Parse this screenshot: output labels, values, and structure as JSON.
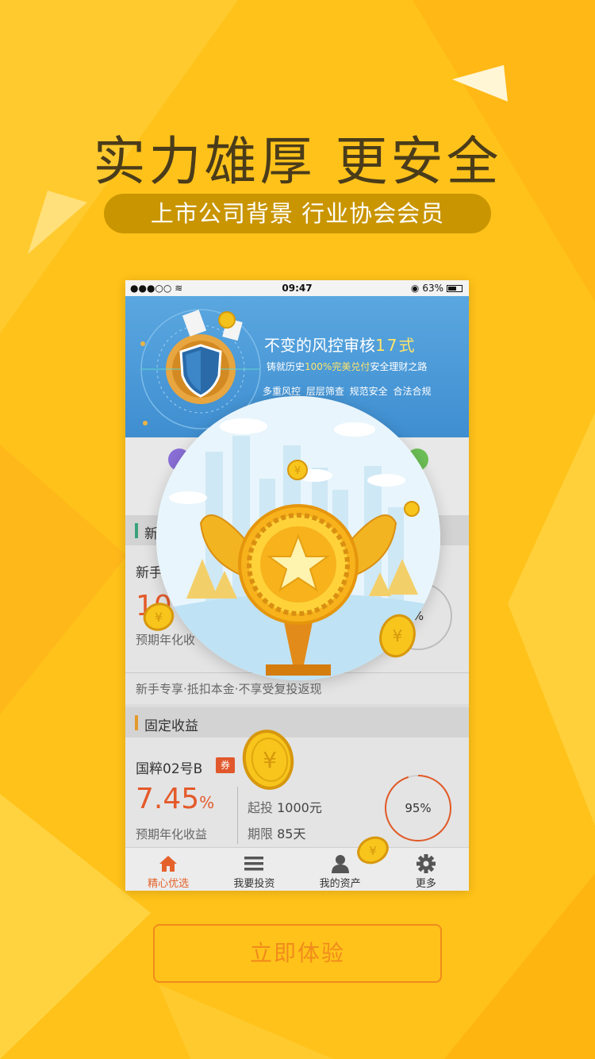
{
  "headline": "实力雄厚 更安全",
  "subheadline": "上市公司背景  行业协会会员",
  "status_bar": {
    "signal": "●●●○○",
    "time": "09:47",
    "battery": "63%"
  },
  "banner": {
    "title_main": "不变的风控审核",
    "title_accent": "17式",
    "sub_prefix": "铸就历史",
    "sub_accent": "100%完美兑付",
    "sub_suffix": "安全理财之路",
    "tags": "多重风控 层层筛查 规范安全 合法合规"
  },
  "newbie_section": {
    "header": "新",
    "product_name": "新手",
    "rate": "10",
    "rate_label": "预期年化收",
    "progress_text": "%",
    "description": "新手专享·抵扣本金·不享受复投返现"
  },
  "fixed_section": {
    "header": "固定收益",
    "product_name": "国粹02号B",
    "coupon_badge": "券",
    "rate_value": "7.45",
    "rate_unit": "%",
    "rate_label": "预期年化收益",
    "min_invest_label": "起投",
    "min_invest_value": "1000元",
    "term_label": "期限",
    "term_value": "85天",
    "progress_text": "95%",
    "progress": 0.95
  },
  "tabbar": [
    {
      "label": "精心优选",
      "icon": "home-icon",
      "active": true
    },
    {
      "label": "我要投资",
      "icon": "list-icon",
      "active": false
    },
    {
      "label": "我的资产",
      "icon": "user-icon",
      "active": false
    },
    {
      "label": "更多",
      "icon": "gear-icon",
      "active": false
    }
  ],
  "cta_label": "立即体验",
  "colors": {
    "background": "#ffc21a",
    "accent_orange": "#e45a2a",
    "cta": "#f08b1c",
    "pill": "#c99500"
  }
}
